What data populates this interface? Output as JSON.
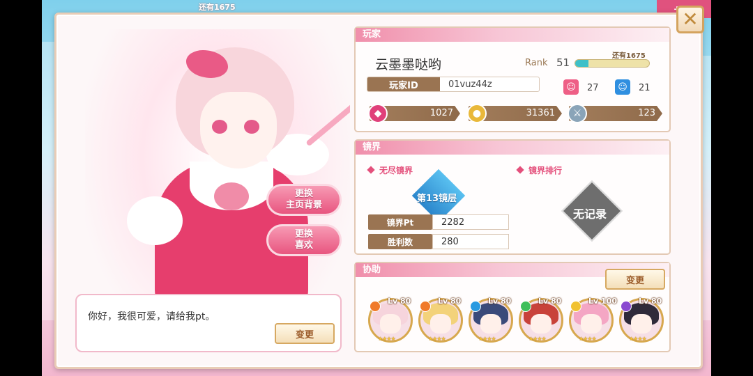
{
  "header": {
    "remaining_text": "还有1675",
    "top_button": "+ME"
  },
  "close_label": "✕",
  "character_buttons": {
    "change_bg": [
      "更换",
      "主页背景"
    ],
    "change_fav": [
      "更换",
      "喜欢"
    ]
  },
  "speech": {
    "text": "你好，我很可爱，请给我pt。",
    "change_label": "变更"
  },
  "player": {
    "section_title": "玩家",
    "name": "云墨墨哒哟",
    "rank_label": "Rank",
    "rank_value": "51",
    "xp_fraction": 0.18,
    "xp_remaining": "还有1675",
    "id_label": "玩家ID",
    "id_value": "01vuz44z",
    "stats": [
      {
        "icon": "pink-face-icon",
        "value": "27",
        "color": "#ee5f86"
      },
      {
        "icon": "blue-face-icon",
        "value": "21",
        "color": "#2f8fe0"
      }
    ],
    "resources": [
      {
        "icon": "gem-icon",
        "value": "1027",
        "color": "#e0407a"
      },
      {
        "icon": "coin-icon",
        "value": "31361",
        "color": "#e9b83a"
      },
      {
        "icon": "sword-icon",
        "value": "123",
        "color": "#8aa4b8"
      }
    ]
  },
  "mirror": {
    "section_title": "镜界",
    "endless_label": "无尽镜界",
    "ranking_label": "镜界排行",
    "floor_label": "第13镜层",
    "no_record": "无记录",
    "rows": [
      {
        "label": "镜界Pt",
        "value": "2282"
      },
      {
        "label": "胜利数",
        "value": "280"
      }
    ]
  },
  "support": {
    "section_title": "协助",
    "change_label": "变更",
    "members": [
      {
        "level": "Lv 80",
        "attr": "fire",
        "attr_color": "#f07a2a",
        "hair": "#f6d4dc"
      },
      {
        "level": "Lv 80",
        "attr": "fire",
        "attr_color": "#f07a2a",
        "hair": "#f3d27a"
      },
      {
        "level": "Lv 80",
        "attr": "water",
        "attr_color": "#2a9ae0",
        "hair": "#3a4a7a"
      },
      {
        "level": "Lv 80",
        "attr": "wood",
        "attr_color": "#3fbf5a",
        "hair": "#c8423a"
      },
      {
        "level": "Lv 100",
        "attr": "light",
        "attr_color": "#f1c232",
        "hair": "#f4a6c4"
      },
      {
        "level": "Lv 80",
        "attr": "dark",
        "attr_color": "#8a4ad0",
        "hair": "#2f2a3a"
      }
    ],
    "star_glyphs": "★★★★"
  }
}
